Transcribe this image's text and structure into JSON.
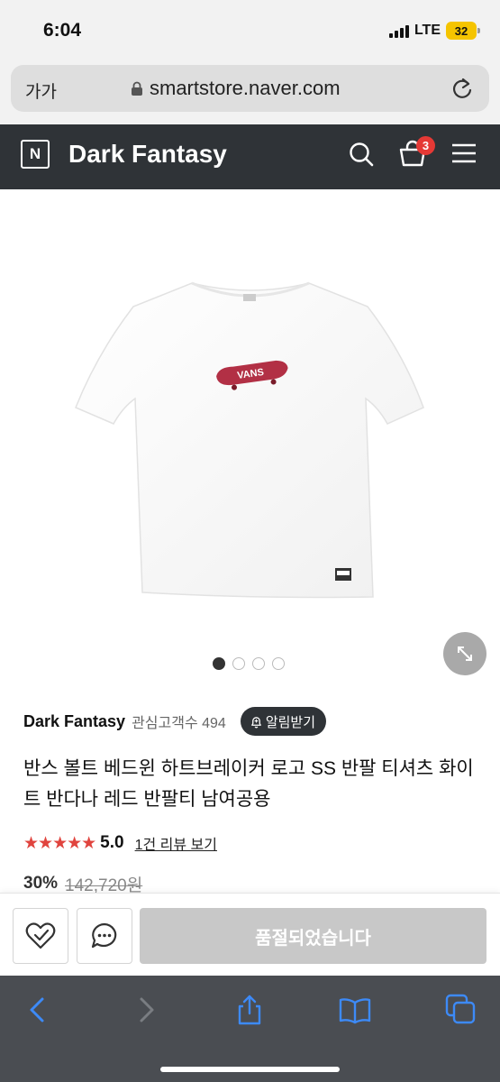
{
  "status_bar": {
    "time": "6:04",
    "network": "LTE",
    "battery": "32"
  },
  "browser": {
    "text_size_label": "가가",
    "url": "smartstore.naver.com"
  },
  "header": {
    "logo_letter": "N",
    "store_name": "Dark Fantasy",
    "cart_count": "3"
  },
  "gallery": {
    "image_count": 4,
    "active_index": 0
  },
  "seller": {
    "name": "Dark Fantasy",
    "followers": "관심고객수 494",
    "notify_label": "알림받기"
  },
  "product": {
    "title": "반스 볼트 베드윈 하트브레이커 로고 SS 반팔 티셔츠 화이트 반다나 레드 반팔티 남여공용",
    "stars": "★★★★★",
    "rating": "5.0",
    "review_link": "1건 리뷰 보기",
    "discount": "30%",
    "original_price": "142,720원"
  },
  "actions": {
    "soldout_label": "품절되었습니다"
  },
  "colors": {
    "header_bg": "#2f3337",
    "star": "#e0443e",
    "badge": "#e53935",
    "toolbar": "#4a4d52",
    "link_blue": "#3d8af7"
  }
}
